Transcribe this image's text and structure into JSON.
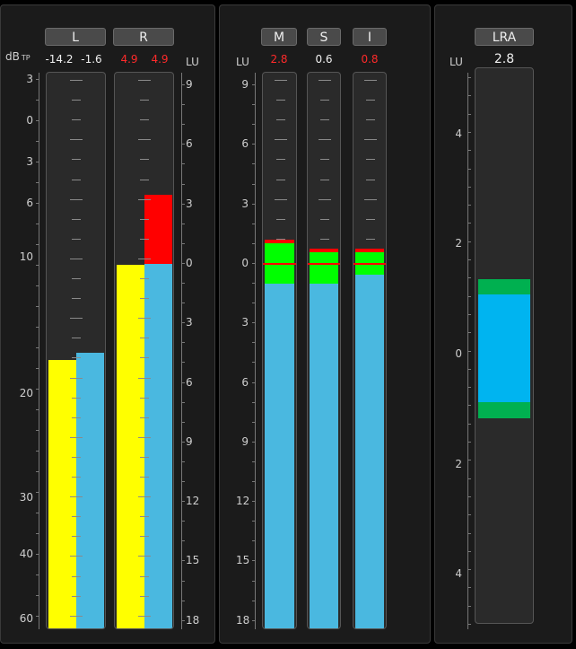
{
  "colors": {
    "peak_yellow": "#ffff00",
    "rms_blue": "#4ab8e0",
    "over_red": "#ff0000",
    "target_green": "#00ff00",
    "lra_blue": "#00b4f0",
    "lra_green": "#00b050"
  },
  "panel1": {
    "unit_left": "dB",
    "unit_left_sub": "TP",
    "unit_right": "LU",
    "channels": [
      {
        "label": "L",
        "peak_value": "-14.2",
        "rms_value": "-1.6",
        "peak_level_db": -17.5,
        "rms_level_lu": 4.5
      },
      {
        "label": "R",
        "peak_value": "4.9",
        "rms_value": "4.9",
        "peak_level_db": -10.5,
        "rms_level_lu": 0,
        "over_top_lu": 3.5
      }
    ],
    "db_ticks": [
      "3",
      "0",
      "3",
      "6",
      "10",
      "20",
      "30",
      "40",
      "60"
    ],
    "lu_ticks": [
      "9",
      "6",
      "3",
      "0",
      "3",
      "6",
      "9",
      "12",
      "15",
      "18"
    ]
  },
  "panel2": {
    "unit": "LU",
    "lu_ticks": [
      "9",
      "6",
      "3",
      "0",
      "3",
      "6",
      "9",
      "12",
      "15",
      "18"
    ],
    "meters": [
      {
        "label": "M",
        "value": "2.8",
        "value_red": true,
        "level_lu": -1.2
      },
      {
        "label": "S",
        "value": "0.6",
        "value_red": false,
        "level_lu": -0.6
      },
      {
        "label": "I",
        "value": "0.8",
        "value_red": true,
        "level_lu": -0.8
      }
    ]
  },
  "panel3": {
    "label": "LRA",
    "value": "2.8",
    "unit": "LU",
    "ticks": [
      "4",
      "2",
      "0",
      "2",
      "4"
    ]
  }
}
